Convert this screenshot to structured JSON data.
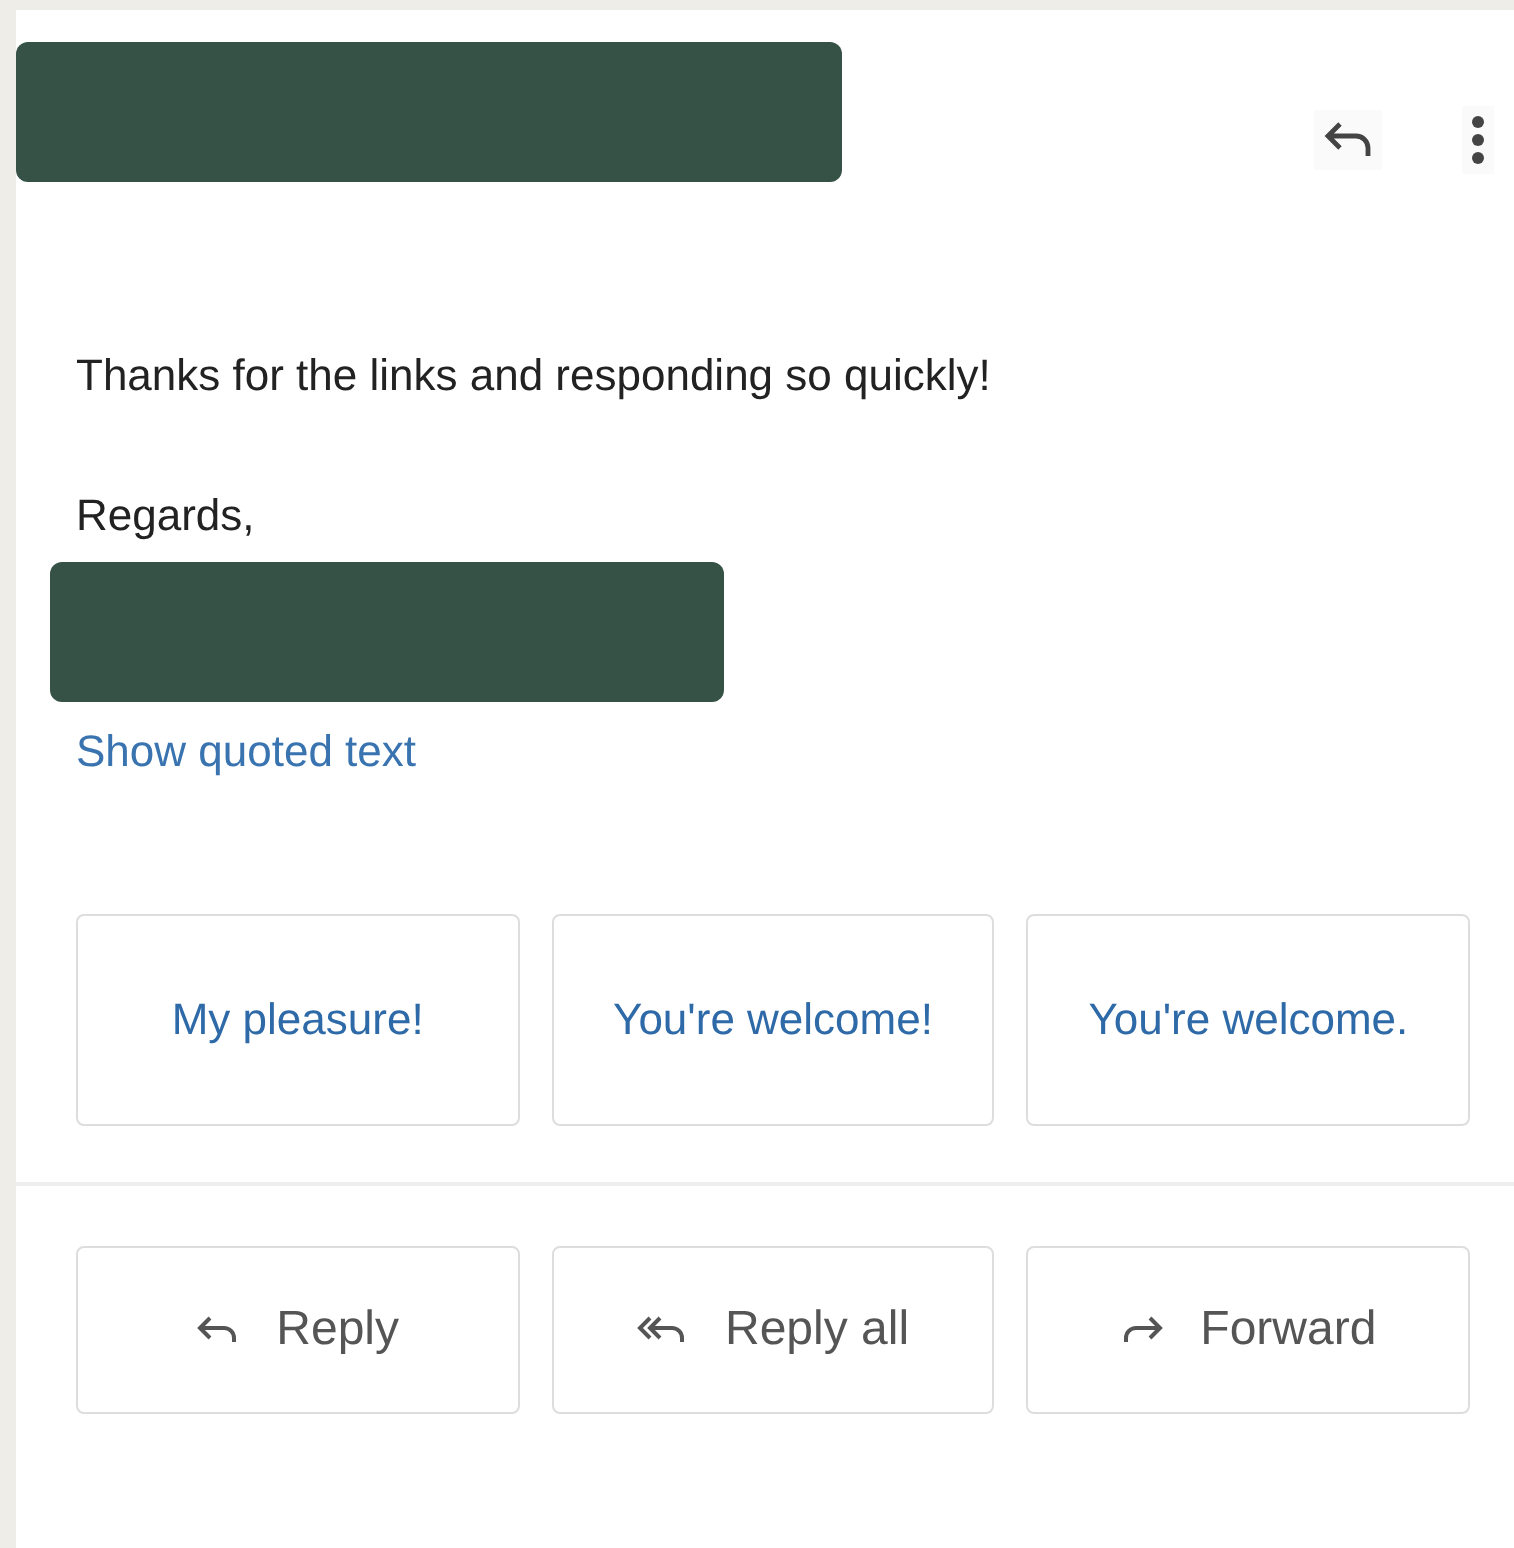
{
  "message": {
    "body": "Thanks for the links and responding so quickly!",
    "closing": "Regards,",
    "show_quoted": "Show quoted text"
  },
  "smart_replies": [
    "My pleasure!",
    "You're welcome!",
    "You're welcome."
  ],
  "actions": [
    {
      "kind": "reply",
      "label": "Reply"
    },
    {
      "kind": "reply_all",
      "label": "Reply all"
    },
    {
      "kind": "forward",
      "label": "Forward"
    }
  ]
}
